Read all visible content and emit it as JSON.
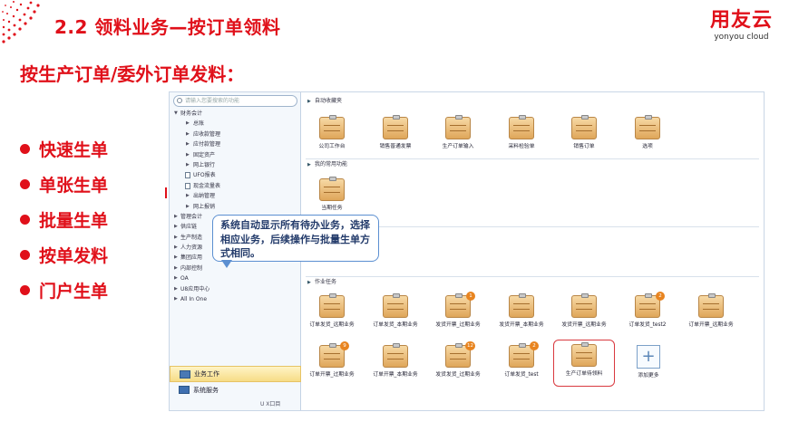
{
  "slide": {
    "title": "2.2 领料业务—按订单领料",
    "subtitle": "按生产订单/委外订单发料：",
    "brand": {
      "name_cn": "用友云",
      "name_en": "yonyou cloud"
    },
    "bullets": [
      "快速生单",
      "单张生单",
      "批量生单",
      "按单发料",
      "门户生单"
    ],
    "accent_color": "#e0101a"
  },
  "app": {
    "search": {
      "placeholder": "请输入您要搜索的功能"
    },
    "tree": [
      {
        "label": "财务会计",
        "level": 0,
        "arrow": "▼"
      },
      {
        "label": "总账",
        "level": 1,
        "arrow": "▶"
      },
      {
        "label": "应收款管理",
        "level": 1,
        "arrow": "▶"
      },
      {
        "label": "应付款管理",
        "level": 1,
        "arrow": "▶"
      },
      {
        "label": "固定资产",
        "level": 1,
        "arrow": "▶"
      },
      {
        "label": "网上银行",
        "level": 1,
        "arrow": "▶"
      },
      {
        "label": "UFO报表",
        "level": 1,
        "arrow": "",
        "doc": true
      },
      {
        "label": "现金流量表",
        "level": 1,
        "arrow": "",
        "doc": true
      },
      {
        "label": "出纳管理",
        "level": 1,
        "arrow": "▶"
      },
      {
        "label": "网上报销",
        "level": 1,
        "arrow": "▶"
      },
      {
        "label": "管理会计",
        "level": 0,
        "arrow": "▶"
      },
      {
        "label": "供应链",
        "level": 0,
        "arrow": "▶"
      },
      {
        "label": "生产制造",
        "level": 0,
        "arrow": "▶"
      },
      {
        "label": "人力资源",
        "level": 0,
        "arrow": "▶"
      },
      {
        "label": "集团应用",
        "level": 0,
        "arrow": "▶"
      },
      {
        "label": "内部控制",
        "level": 0,
        "arrow": "▶"
      },
      {
        "label": "OA",
        "level": 0,
        "arrow": "▶"
      },
      {
        "label": "U8应用中心",
        "level": 0,
        "arrow": "▶"
      },
      {
        "label": "All In One",
        "level": 0,
        "arrow": "▶"
      }
    ],
    "nav": {
      "business": "业务工作",
      "system": "系统服务",
      "trail": "U  X口目"
    },
    "sections": {
      "favorites": {
        "title": "自动收藏夹",
        "tiles": [
          "公司工作台",
          "销售普通发票",
          "生产订单输入",
          "采料检验单",
          "销售订单",
          "选项"
        ]
      },
      "common": {
        "title": "我的常用功能",
        "tiles": [
          "当期任务"
        ]
      },
      "tasks": {
        "title": "作业任务",
        "tiles": [
          {
            "label": "订单发货_远期业务",
            "badge": ""
          },
          {
            "label": "订单发货_本期业务",
            "badge": ""
          },
          {
            "label": "发货开票_过期业务",
            "badge": "1"
          },
          {
            "label": "发货开票_本期业务",
            "badge": ""
          },
          {
            "label": "发货开票_远期业务",
            "badge": ""
          },
          {
            "label": "订单发货_test2",
            "badge": "2"
          },
          {
            "label": "订单开票_远期业务",
            "badge": ""
          },
          {
            "label": "订单开票_过期业务",
            "badge": "9"
          },
          {
            "label": "订单开票_本期业务",
            "badge": ""
          },
          {
            "label": "发货发货_过期业务",
            "badge": "12"
          },
          {
            "label": "订单发货_test",
            "badge": "2"
          },
          {
            "label": "生产订单待领料",
            "badge": ""
          }
        ],
        "add_more": "添加更多"
      }
    },
    "callout": "系统自动显示所有待办业务，选择相应业务，后续操作与批量生单方式相同。"
  }
}
